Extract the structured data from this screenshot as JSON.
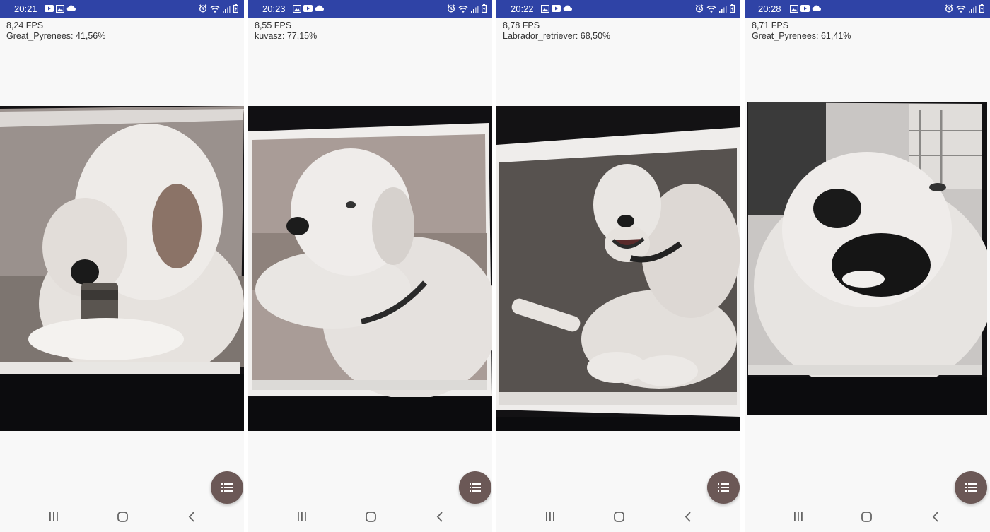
{
  "screens": [
    {
      "time": "20:21",
      "fps_text": "8,24 FPS",
      "prediction_text": "Great_Pyrenees: 41,56%"
    },
    {
      "time": "20:23",
      "fps_text": "8,55 FPS",
      "prediction_text": "kuvasz: 77,15%"
    },
    {
      "time": "20:22",
      "fps_text": "8,78 FPS",
      "prediction_text": "Labrador_retriever: 68,50%"
    },
    {
      "time": "20:28",
      "fps_text": "8,71 FPS",
      "prediction_text": "Great_Pyrenees: 61,41%"
    }
  ],
  "colors": {
    "status_bar": "#2f43a6",
    "fab": "#6b5856",
    "background": "#f8f8f8"
  },
  "icons": {
    "status_left": [
      "youtube-icon",
      "image-icon",
      "cloud-icon"
    ],
    "status_right": [
      "alarm-icon",
      "wifi-icon",
      "signal-icon",
      "battery-icon"
    ],
    "fab": "list-icon",
    "nav": [
      "recents-icon",
      "home-icon",
      "back-icon"
    ]
  }
}
